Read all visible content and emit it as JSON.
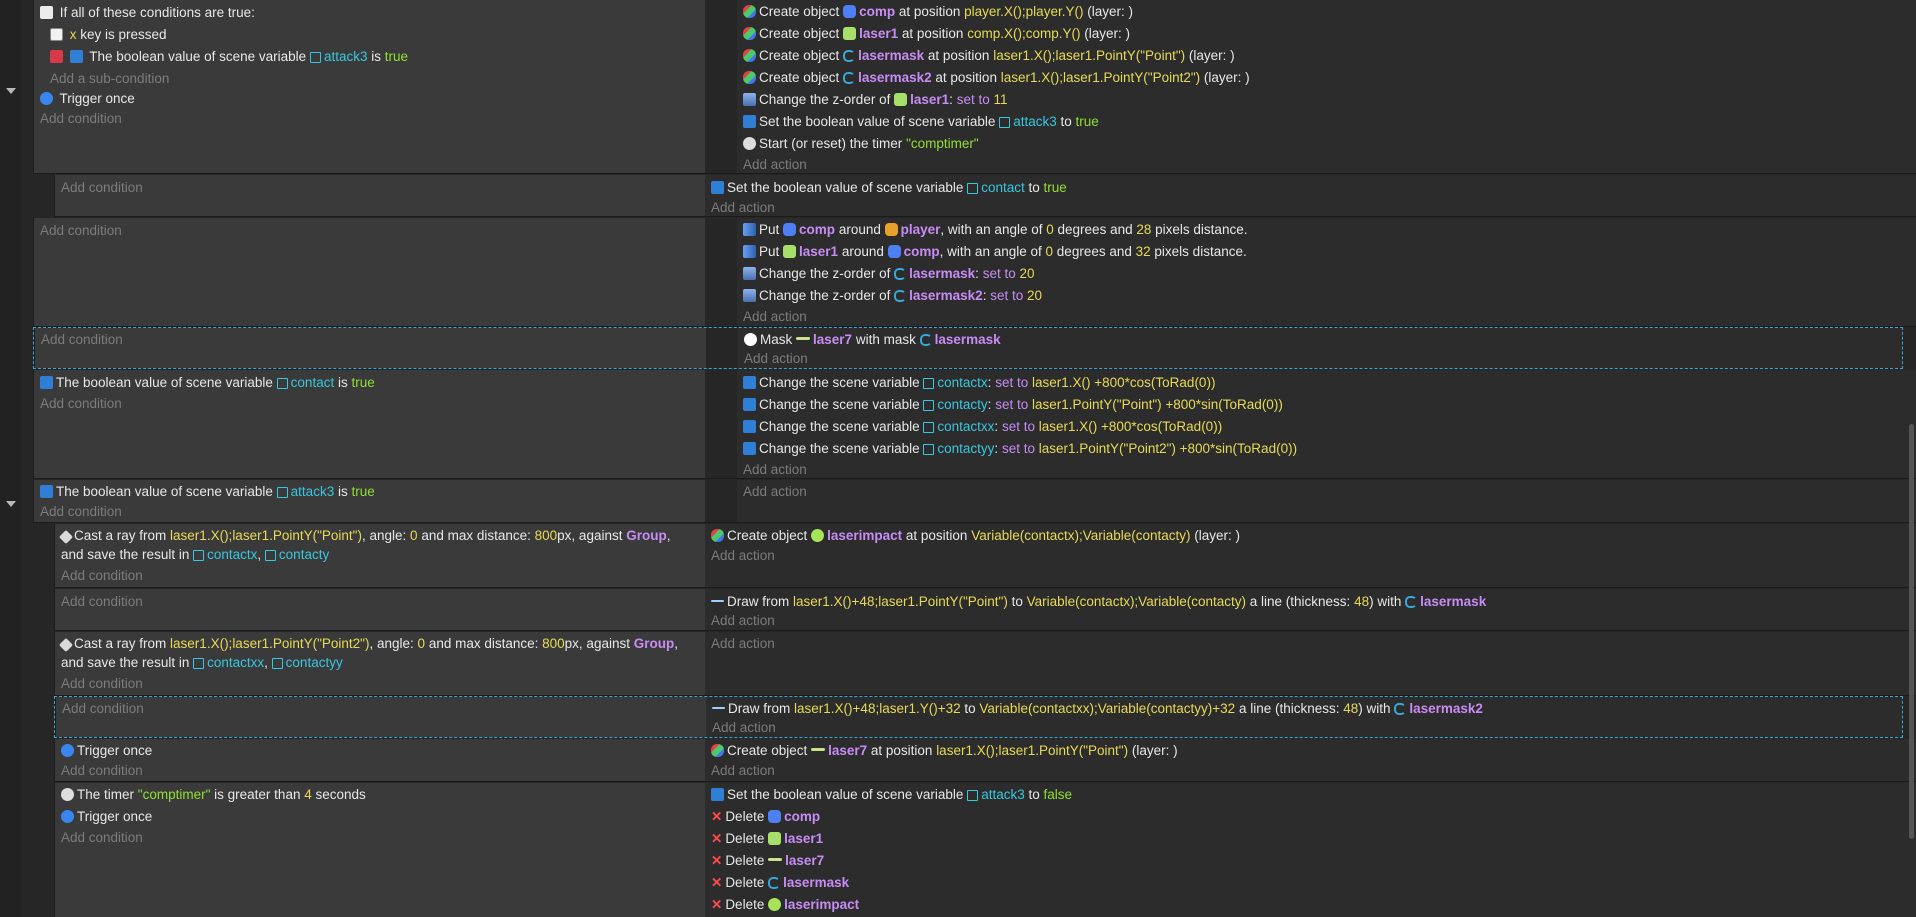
{
  "texts": {
    "if_all": "If all of these conditions are true:",
    "x_key": "x",
    "key_pressed": "key is pressed",
    "bool_of_scene_var": "The boolean value of scene variable",
    "is": "is",
    "true": "true",
    "false": "false",
    "add_subcondition": "Add a sub-condition",
    "trigger_once": "Trigger once",
    "add_condition": "Add condition",
    "add_action": "Add action",
    "create_object": "Create object",
    "at_position": "at position",
    "layer": "(layer: )",
    "change_z": "Change the z-order of",
    "set_to": "set to",
    "set_bool_scene_var": "Set the boolean value of scene variable",
    "to": "to",
    "start_timer": "Start (or reset) the timer",
    "put": "Put",
    "around": "around",
    "with_angle": ", with an angle of",
    "degrees_and": "degrees and",
    "pixels_distance": "pixels distance.",
    "mask": "Mask",
    "with_mask": "with mask",
    "change_scene_var": "Change the scene variable",
    "cast_ray": "Cast a ray from",
    "angle": ", angle:",
    "and_max_distance": "and max distance:",
    "px_against": "px, against",
    "and_save_result": "and save the result in",
    "draw_from": "Draw from",
    "a_line_thickness": "a line (thickness:",
    "with": "with",
    "the_timer": "The timer",
    "is_greater_than": "is greater than",
    "seconds": "seconds",
    "delete": "Delete"
  },
  "objects": {
    "comp": "comp",
    "laser1": "laser1",
    "lasermask": "lasermask",
    "lasermask2": "lasermask2",
    "player": "player",
    "laser7": "laser7",
    "laserimpact": "laserimpact",
    "group": "Group"
  },
  "vars": {
    "attack3": "attack3",
    "contact": "contact",
    "contactx": "contactx",
    "contacty": "contacty",
    "contactxx": "contactxx",
    "contactyy": "contactyy"
  },
  "values": {
    "player_pos": "player.X();player.Y()",
    "comp_pos": "comp.X();comp.Y()",
    "laser1_point": "laser1.X();laser1.PointY(\"Point\")",
    "laser1_point2": "laser1.X();laser1.PointY(\"Point2\")",
    "z11": "11",
    "z20": "20",
    "comptimer": "\"comptimer\"",
    "angle0": "0",
    "dist28": "28",
    "dist32": "32",
    "cx_expr": "laser1.X() +800*cos(ToRad(0))",
    "cy_expr": "laser1.PointY(\"Point\") +800*sin(ToRad(0))",
    "cxx_expr": "laser1.X() +800*cos(ToRad(0))",
    "cyy_expr": "laser1.PointY(\"Point2\") +800*sin(ToRad(0))",
    "contact_pos": "Variable(contactx);Variable(contacty)",
    "ray_dist": "800",
    "draw1_from": "laser1.X()+48;laser1.PointY(\"Point\")",
    "draw1_to": "Variable(contactx);Variable(contacty)",
    "thickness": "48",
    "draw2_from": "laser1.X()+48;laser1.Y()+32",
    "draw2_to": "Variable(contactxx);Variable(contactyy)+32",
    "seconds4": "4"
  },
  "punct": {
    "colon": ":",
    "comma": ",",
    "close_paren": ")"
  }
}
